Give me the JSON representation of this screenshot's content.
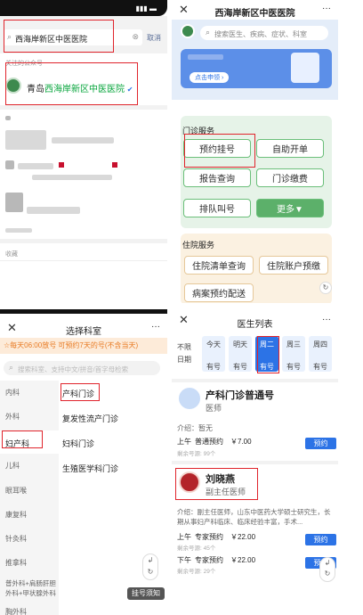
{
  "p1": {
    "search": {
      "value": "西海岸新区中医医院",
      "cancel": "取消"
    },
    "section_label": "关注的公众号",
    "account": {
      "prefix": "青岛",
      "highlight": "西海岸新区中医医院"
    },
    "footer_label": "收藏"
  },
  "p2": {
    "title": "西海岸新区中医医院",
    "search_placeholder": "搜索医生、疾病、症状、科室",
    "banner_button": "点击申领 ›",
    "outpatient": {
      "title": "门诊服务",
      "buttons": [
        "预约挂号",
        "自助开单",
        "报告查询",
        "门诊缴费",
        "排队叫号",
        "更多▼"
      ]
    },
    "inpatient": {
      "title": "住院服务",
      "buttons": [
        "住院清单查询",
        "住院账户预缴",
        "病案预约配送"
      ]
    }
  },
  "p3": {
    "title": "选择科室",
    "notice": "☆每天06:00放号 可预约7天的号(不含当天)",
    "search_placeholder": "搜索科室、支持中文/拼音/首字母检索",
    "categories": [
      "内科",
      "外科",
      "妇产科",
      "儿科",
      "眼耳喉",
      "康复科",
      "针灸科",
      "推拿科",
      "普外科+肩肠肝胆外科+甲状腺外科",
      "胸外科"
    ],
    "departments": [
      "产科门诊",
      "复发性流产门诊",
      "妇科门诊",
      "生殖医学科门诊"
    ],
    "tip_button": "挂号须知"
  },
  "p4": {
    "title": "医生列表",
    "date_cells": [
      {
        "top": "不限",
        "bottom": "日期"
      },
      {
        "top": "今天",
        "bottom": "有号"
      },
      {
        "top": "明天",
        "bottom": "有号"
      },
      {
        "top": "周二",
        "bottom": "有号"
      },
      {
        "top": "周三",
        "bottom": "有号"
      },
      {
        "top": "周四",
        "bottom": "有号"
      }
    ],
    "doc1": {
      "name": "产科门诊普通号",
      "title": "医师",
      "intro": "介绍：暂无",
      "session": "上午",
      "type": "普通预约",
      "price": "￥7.00",
      "remain": "剩余号源: 99个",
      "book": "预约"
    },
    "doc2": {
      "name": "刘晓燕",
      "title": "副主任医师",
      "intro": "介绍：副主任医师，山东中医药大学硕士研究生，长期从事妇产科临床、临床经验丰富，手术...",
      "am_session": "上午",
      "am_type": "专家预约",
      "am_price": "￥22.00",
      "am_remain": "剩余号源: 45个",
      "pm_session": "下午",
      "pm_type": "专家预约",
      "pm_price": "￥22.00",
      "pm_remain": "剩余号源: 29个",
      "book": "预约"
    }
  }
}
